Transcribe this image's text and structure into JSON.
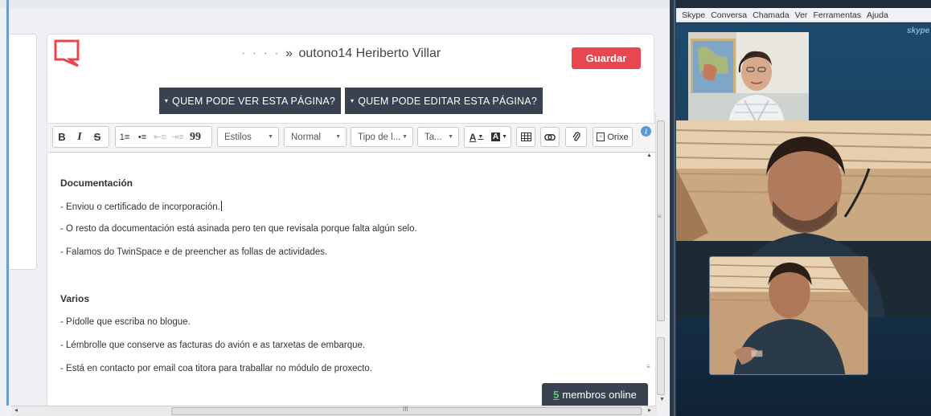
{
  "editor": {
    "title_dots": "· · · ·",
    "title_arrow": "»",
    "title": "outono14 Heriberto Villar",
    "save_label": "Guardar",
    "perm_view_label": "QUEM PODE VER ESTA PÁGINA?",
    "perm_edit_label": "QUEM PODE EDITAR ESTA PÁGINA?",
    "caret": "▾",
    "toolbar": {
      "bold": "B",
      "italic": "I",
      "strike": "S",
      "numbered_list": "1≡",
      "bullet_list": "•≡",
      "outdent": "⇤≡",
      "indent": "⇥≡",
      "quote": "99",
      "styles_label": "Estilos",
      "format_label": "Normal",
      "font_label": "Tipo de l...",
      "size_label": "Ta...",
      "text_color": "A",
      "bg_color": "A",
      "source_label": "Orixe",
      "info": "i"
    },
    "content": {
      "heading1": "Documentación",
      "line1": "- Enviou o certificado de incorporación.",
      "line2": "- O resto da documentación está asinada pero ten que revisala porque falta algún selo.",
      "line3": "- Falamos do TwinSpace e de preencher as follas de actividades.",
      "heading2": "Varios",
      "line4": "- Pídolle que escriba no blogue.",
      "line5": "- Lémbrolle que conserve as facturas do avión e as tarxetas de embarque.",
      "line6": "- Está en contacto por email coa titora para traballar no módulo de proxecto."
    },
    "members_count": "5",
    "members_label": "membros online",
    "scroll_grip": "≡",
    "hscroll_grip": "III",
    "colors": {
      "save": "#e8474f",
      "dark_button": "#3a4150",
      "members_count": "#5cd05c"
    }
  },
  "skype": {
    "menu": [
      "Skype",
      "Conversa",
      "Chamada",
      "Ver",
      "Ferramentas",
      "Ajuda"
    ],
    "logo": "skype"
  }
}
